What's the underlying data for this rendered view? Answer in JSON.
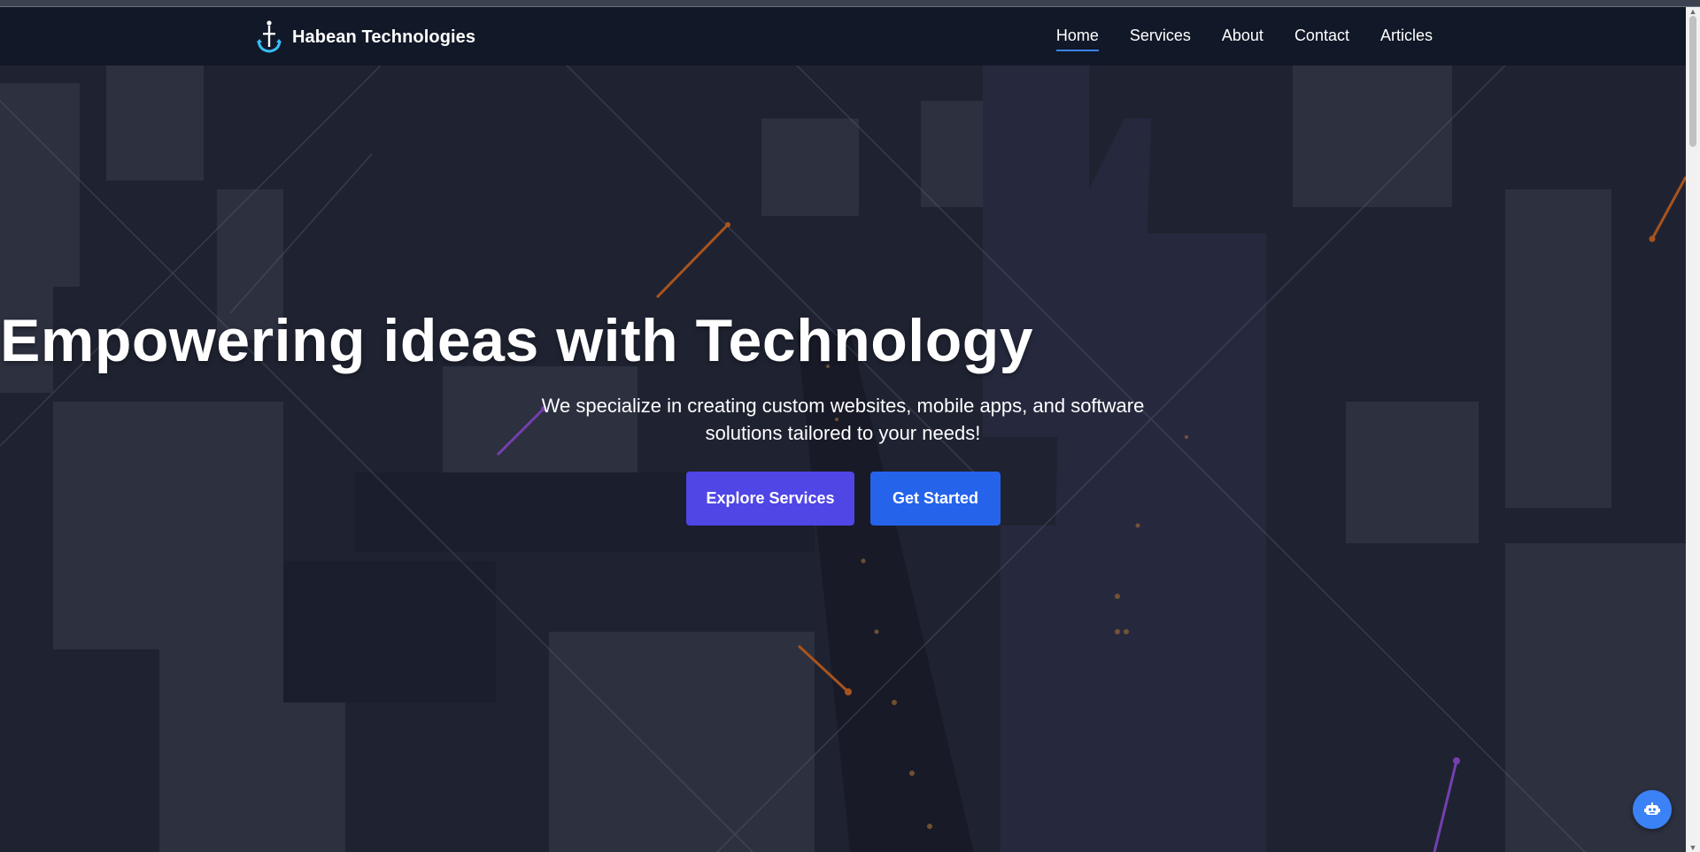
{
  "brand": {
    "name": "Habean Technologies",
    "icon": "anchor-icon"
  },
  "nav": {
    "items": [
      {
        "label": "Home",
        "active": true
      },
      {
        "label": "Services",
        "active": false
      },
      {
        "label": "About",
        "active": false
      },
      {
        "label": "Contact",
        "active": false
      },
      {
        "label": "Articles",
        "active": false
      }
    ]
  },
  "hero": {
    "title": "Empowering ideas with Technology",
    "subtitle": "We specialize in creating custom websites, mobile apps, and software solutions tailored to your needs!",
    "primary_button": "Explore Services",
    "secondary_button": "Get Started"
  },
  "chat": {
    "icon": "robot-icon"
  },
  "colors": {
    "nav_bg": "#111827",
    "accent_blue": "#3b82f6",
    "explore_button": "#4f46e5",
    "start_button": "#2563eb",
    "orange_line": "#f97316",
    "purple_line": "#a855f7"
  }
}
